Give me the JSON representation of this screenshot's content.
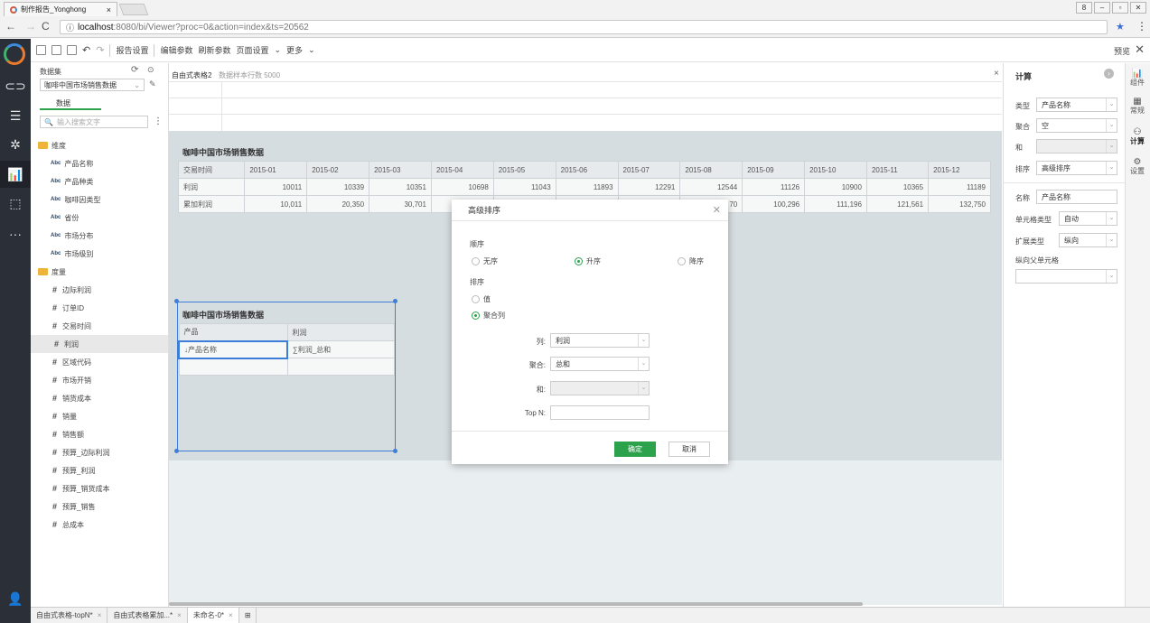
{
  "browser": {
    "tab_title": "制作报告_Yonghong",
    "url_host": "localhost",
    "url_rest": ":8080/bi/Viewer?proc=0&action=index&ts=20562"
  },
  "toolbar": {
    "report_settings": "报告设置",
    "edit_params": "编辑参数",
    "refresh_params": "刷新参数",
    "page_settings": "页面设置",
    "more": "更多",
    "preview": "预览"
  },
  "left_panel": {
    "dataset_label": "数据集",
    "dataset_value": "咖啡中国市场销售数据",
    "data_tab": "数据",
    "search_placeholder": "输入搜索文字",
    "dimension_folder": "维度",
    "dimensions": [
      "产品名称",
      "产品种类",
      "咖啡因类型",
      "省份",
      "市场分布",
      "市场级别"
    ],
    "measure_folder": "度量",
    "measures": [
      "边际利润",
      "订单ID",
      "交易时间",
      "利润",
      "区域代码",
      "市场开销",
      "销货成本",
      "销量",
      "销售额",
      "预算_边际利润",
      "预算_利润",
      "预算_销货成本",
      "预算_销售",
      "总成本"
    ]
  },
  "canvas": {
    "tab_label": "自由式表格2",
    "row_count": "数据样本行数 5000",
    "table1_title": "咖啡中国市场销售数据",
    "table1_header": [
      "交易时间",
      "2015-01",
      "2015-02",
      "2015-03",
      "2015-04",
      "2015-05",
      "2015-06",
      "2015-07",
      "2015-08",
      "2015-09",
      "2015-10",
      "2015-11",
      "2015-12"
    ],
    "table1_row1": [
      "利润",
      "10011",
      "10339",
      "10351",
      "10698",
      "11043",
      "11893",
      "12291",
      "12544",
      "11126",
      "10900",
      "10365",
      "11189"
    ],
    "table1_row2": [
      "累加利润",
      "10,011",
      "20,350",
      "30,701",
      "",
      "",
      "",
      "",
      "70",
      "100,296",
      "111,196",
      "121,561",
      "132,750"
    ],
    "table2_title": "咖啡中国市场销售数据",
    "table2_header": [
      "产品",
      "利润"
    ],
    "table2_row": [
      "↓产品名称",
      "∑利润_总和"
    ]
  },
  "right_panel": {
    "title": "计算",
    "type_label": "类型",
    "type_value": "产品名称",
    "agg_label": "聚合",
    "agg_value": "空",
    "and_label": "和",
    "sort_label": "排序",
    "sort_value": "高级排序",
    "name_label": "名称",
    "name_value": "产品名称",
    "cell_type_label": "单元格类型",
    "cell_type_value": "自动",
    "expand_label": "扩展类型",
    "expand_value": "纵向",
    "parent_label": "纵向父单元格"
  },
  "right_side": [
    "组件",
    "常规",
    "计算",
    "设置"
  ],
  "dialog": {
    "title": "高级排序",
    "order_label": "顺序",
    "order_none": "无序",
    "order_asc": "升序",
    "order_desc": "降序",
    "sort_label": "排序",
    "sort_value": "值",
    "sort_agg": "聚合列",
    "col_label": "列:",
    "col_value": "利润",
    "agg_label": "聚合:",
    "agg_value": "总和",
    "and_label": "和:",
    "topn_label": "Top N:",
    "ok": "确定",
    "cancel": "取消"
  },
  "status_tabs": [
    "自由式表格-topN*",
    "自由式表格累加...*",
    "未命名-0*"
  ]
}
